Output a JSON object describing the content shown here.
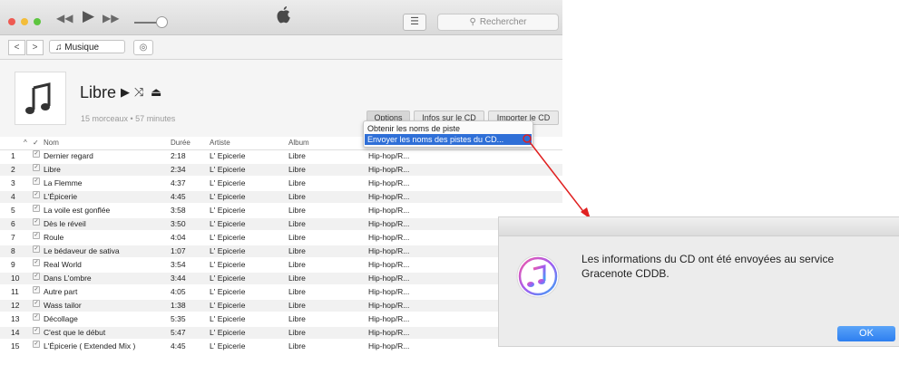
{
  "toolbar": {
    "rewind_icon": "rewind-icon",
    "play_icon": "play-icon",
    "forward_icon": "fast-forward-icon",
    "volume_level": 0.75,
    "list_icon": "list-icon",
    "search_placeholder": "Rechercher"
  },
  "navigation": {
    "back": "<",
    "forward": ">",
    "library": "Musique",
    "library_icon": "music-note-icon",
    "cd_icon": "cd-icon"
  },
  "album": {
    "title": "Libre",
    "meta": "15 morceaux • 57 minutes",
    "buttons": {
      "options": "Options",
      "info": "Infos sur le CD",
      "import": "Importer le CD"
    }
  },
  "columns": {
    "check": "✓",
    "name": "Nom",
    "duration": "Durée",
    "artist": "Artiste",
    "album": "Album"
  },
  "menu": {
    "items": [
      "Obtenir les noms de piste",
      "Envoyer les noms des pistes du CD..."
    ]
  },
  "tracks": [
    {
      "n": "1",
      "name": "Dernier regard",
      "dur": "2:18",
      "artist": "L' Epicerie",
      "album": "Libre",
      "genre": "Hip-hop/R..."
    },
    {
      "n": "2",
      "name": "Libre",
      "dur": "2:34",
      "artist": "L' Epicerie",
      "album": "Libre",
      "genre": "Hip-hop/R..."
    },
    {
      "n": "3",
      "name": "La Flemme",
      "dur": "4:37",
      "artist": "L' Epicerie",
      "album": "Libre",
      "genre": "Hip-hop/R..."
    },
    {
      "n": "4",
      "name": "L'Épicerie",
      "dur": "4:45",
      "artist": "L' Epicerie",
      "album": "Libre",
      "genre": "Hip-hop/R..."
    },
    {
      "n": "5",
      "name": "La voile est gonflée",
      "dur": "3:58",
      "artist": "L' Epicerie",
      "album": "Libre",
      "genre": "Hip-hop/R..."
    },
    {
      "n": "6",
      "name": "Dès le réveil",
      "dur": "3:50",
      "artist": "L' Epicerie",
      "album": "Libre",
      "genre": "Hip-hop/R..."
    },
    {
      "n": "7",
      "name": "Roule",
      "dur": "4:04",
      "artist": "L' Epicerie",
      "album": "Libre",
      "genre": "Hip-hop/R..."
    },
    {
      "n": "8",
      "name": "Le bédaveur de sativa",
      "dur": "1:07",
      "artist": "L' Epicerie",
      "album": "Libre",
      "genre": "Hip-hop/R..."
    },
    {
      "n": "9",
      "name": "Real World",
      "dur": "3:54",
      "artist": "L' Epicerie",
      "album": "Libre",
      "genre": "Hip-hop/R..."
    },
    {
      "n": "10",
      "name": "Dans L'ombre",
      "dur": "3:44",
      "artist": "L' Epicerie",
      "album": "Libre",
      "genre": "Hip-hop/R..."
    },
    {
      "n": "11",
      "name": "Autre part",
      "dur": "4:05",
      "artist": "L' Epicerie",
      "album": "Libre",
      "genre": "Hip-hop/R..."
    },
    {
      "n": "12",
      "name": "Wass tailor",
      "dur": "1:38",
      "artist": "L' Epicerie",
      "album": "Libre",
      "genre": "Hip-hop/R..."
    },
    {
      "n": "13",
      "name": "Décollage",
      "dur": "5:35",
      "artist": "L' Epicerie",
      "album": "Libre",
      "genre": "Hip-hop/R..."
    },
    {
      "n": "14",
      "name": "C'est que le début",
      "dur": "5:47",
      "artist": "L' Epicerie",
      "album": "Libre",
      "genre": "Hip-hop/R..."
    },
    {
      "n": "15",
      "name": "L'Épicerie ( Extended Mix )",
      "dur": "4:45",
      "artist": "L' Epicerie",
      "album": "Libre",
      "genre": "Hip-hop/R..."
    }
  ],
  "dialog": {
    "message": "Les informations du CD ont été envoyées au service Gracenote CDDB.",
    "ok": "OK",
    "icon": "itunes-icon"
  },
  "colors": {
    "menu_highlight": "#2f6fd7",
    "arrow": "#e02020",
    "ok_button": "#2d7ff0"
  }
}
